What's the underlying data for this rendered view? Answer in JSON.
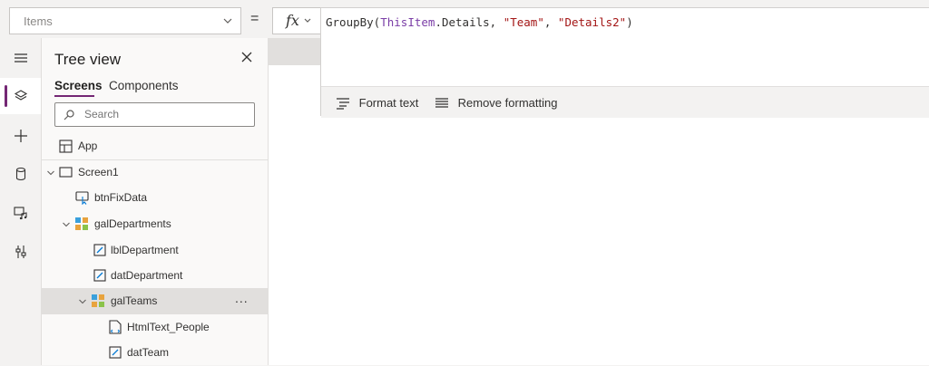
{
  "formula_bar": {
    "property": "Items",
    "equals": "=",
    "fx": "fx",
    "formula": {
      "fn": "GroupBy(",
      "ref1": "ThisItem",
      "mid": ".Details, ",
      "str1": "\"Team\"",
      "comma": ", ",
      "str2": "\"Details2\"",
      "close": ")"
    },
    "toolbar": {
      "format_text": "Format text",
      "remove_formatting": "Remove formatting"
    }
  },
  "rail": {
    "items": [
      {
        "icon": "hamburger-icon"
      },
      {
        "icon": "layers-icon",
        "active": true
      },
      {
        "icon": "plus-icon"
      },
      {
        "icon": "database-icon"
      },
      {
        "icon": "media-icon"
      },
      {
        "icon": "tools-icon"
      }
    ]
  },
  "tree_view": {
    "title": "Tree view",
    "tabs": [
      "Screens",
      "Components"
    ],
    "search_placeholder": "Search",
    "items": [
      {
        "label": "App",
        "icon": "app-icon"
      },
      {
        "label": "Screen1",
        "icon": "screen-icon"
      },
      {
        "label": "btnFixData",
        "icon": "button-icon"
      },
      {
        "label": "galDepartments",
        "icon": "gallery-icon"
      },
      {
        "label": "lblDepartment",
        "icon": "edit-label-icon"
      },
      {
        "label": "datDepartment",
        "icon": "edit-label-icon"
      },
      {
        "label": "galTeams",
        "icon": "gallery-icon",
        "selected": true,
        "more": "..."
      },
      {
        "label": "HtmlText_People",
        "icon": "html-text-icon"
      },
      {
        "label": "datTeam",
        "icon": "edit-label-icon"
      }
    ]
  },
  "colors": {
    "accent": "#742774",
    "string": "#a31515",
    "reference": "#7a3da6"
  }
}
